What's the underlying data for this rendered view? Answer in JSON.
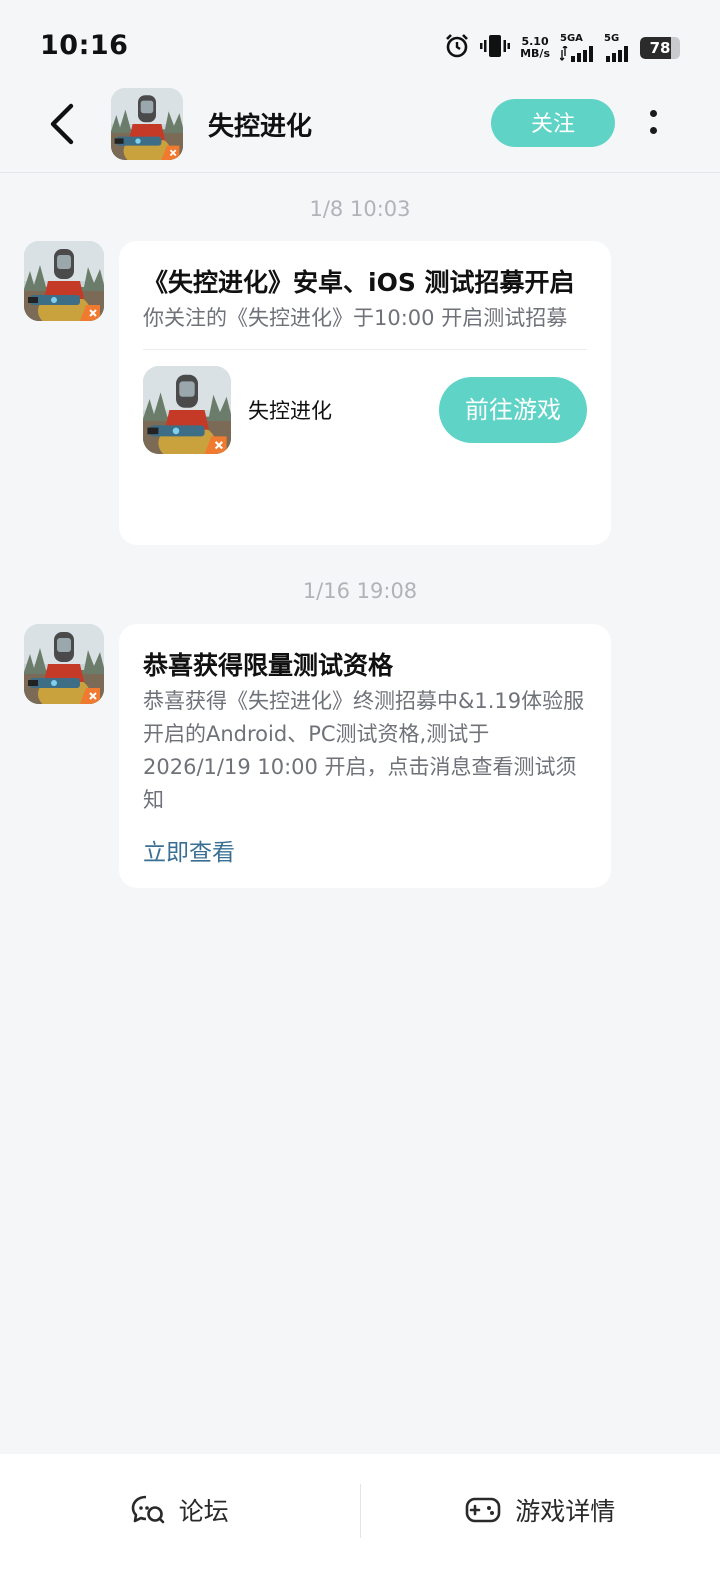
{
  "status_bar": {
    "time": "10:16",
    "net_speed_value": "5.10",
    "net_speed_unit": "MB/s",
    "signal_1": "5GA",
    "signal_2": "5G",
    "battery_level": "78",
    "battery_fraction": 0.78
  },
  "header": {
    "title": "失控进化",
    "follow_label": "关注"
  },
  "messages": [
    {
      "timestamp": "1/8  10:03",
      "title": "《失控进化》安卓、iOS 测试招募开启",
      "body": "你关注的《失控进化》于10:00 开启测试招募",
      "game_name": "失控进化",
      "action_label": "前往游戏"
    },
    {
      "timestamp": "1/16  19:08",
      "title": "恭喜获得限量测试资格",
      "body": "恭喜获得《失控进化》终测招募中&1.19体验服开启的Android、PC测试资格,测试于2026/1/19 10:00 开启，点击消息查看测试须知",
      "link_label": "立即查看"
    }
  ],
  "bottom_bar": {
    "forum_label": "论坛",
    "details_label": "游戏详情"
  },
  "colors": {
    "accent": "#5fd3c6",
    "link": "#3a6f93",
    "background": "#f5f6f8"
  }
}
